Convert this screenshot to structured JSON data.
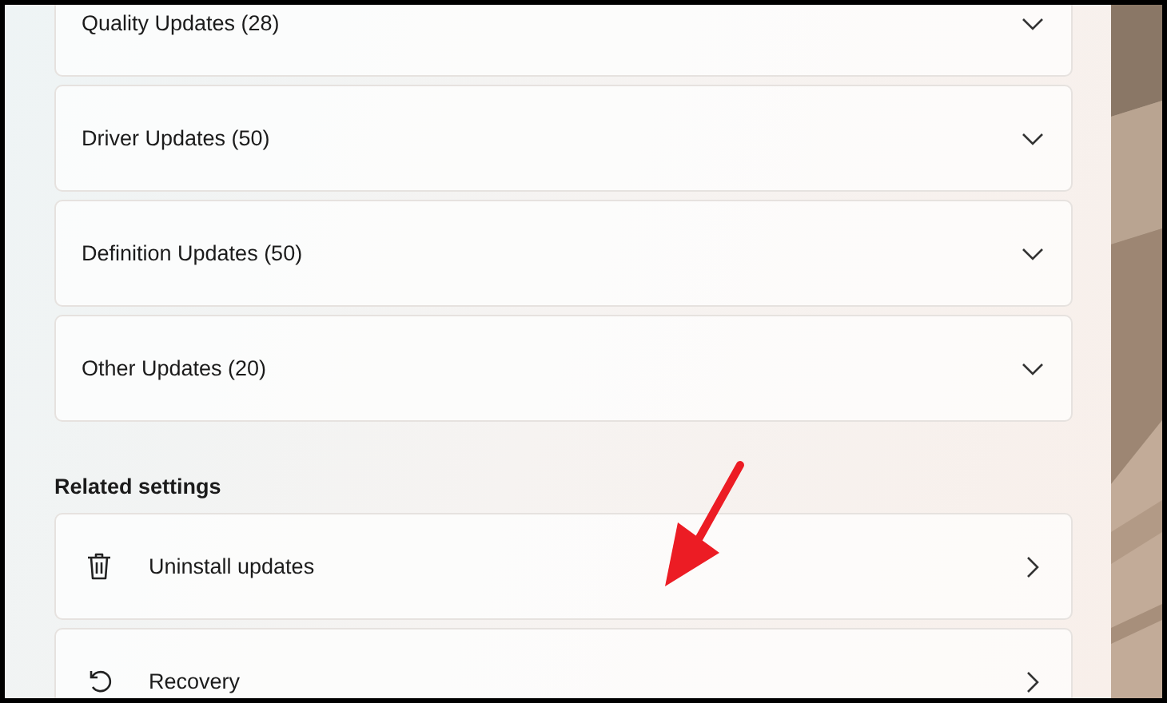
{
  "update_groups": [
    {
      "label": "Quality Updates (28)",
      "expanded": false
    },
    {
      "label": "Driver Updates (50)",
      "expanded": false
    },
    {
      "label": "Definition Updates (50)",
      "expanded": false
    },
    {
      "label": "Other Updates (20)",
      "expanded": false
    }
  ],
  "related_settings": {
    "heading": "Related settings",
    "items": [
      {
        "label": "Uninstall updates",
        "kind": "trash"
      },
      {
        "label": "Recovery",
        "kind": "recovery"
      }
    ]
  },
  "annotation": {
    "kind": "arrow"
  }
}
